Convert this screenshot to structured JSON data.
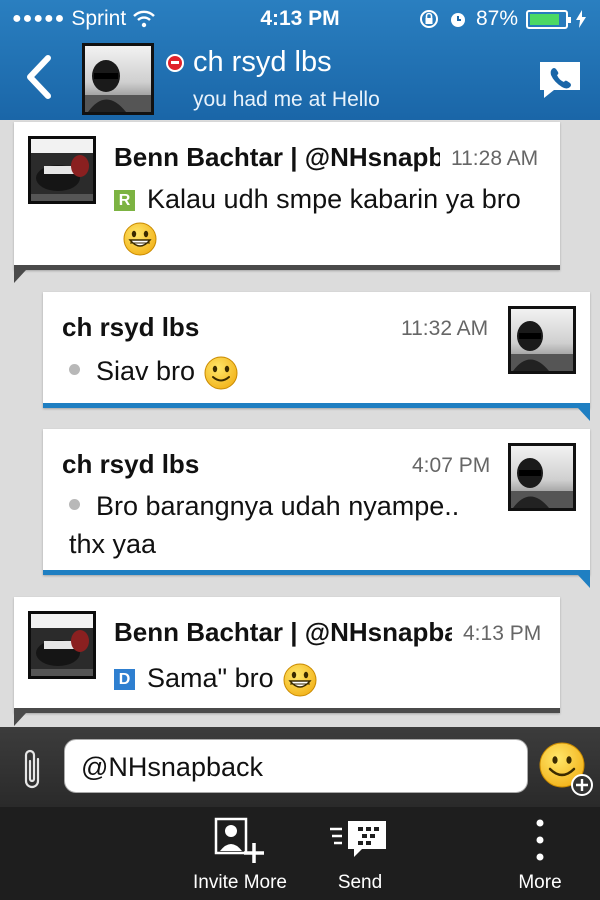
{
  "status_bar": {
    "signal_dots": "●●●●●",
    "carrier": "Sprint",
    "time": "4:13 PM",
    "battery_percent": "87%",
    "battery_level": 0.87
  },
  "header": {
    "contact_name": "ch rsyd lbs",
    "contact_status": "you had me at Hello"
  },
  "messages": [
    {
      "sender": "Benn Bachtar | @NHsnapback",
      "time": "11:28 AM",
      "badge": "R",
      "text": "Kalau udh smpe kabarin ya bro",
      "emoji": "grin"
    },
    {
      "sender": "ch rsyd lbs",
      "time": "11:32 AM",
      "text": "Siav bro",
      "emoji": "smile"
    },
    {
      "sender": "ch rsyd lbs",
      "time": "4:07 PM",
      "text": "Bro barangnya udah nyampe.. thx yaa"
    },
    {
      "sender": "Benn Bachtar | @NHsnapback",
      "time": "4:13 PM",
      "badge": "D",
      "text": "Sama\" bro",
      "emoji": "grin"
    }
  ],
  "compose": {
    "value": "@NHsnapback"
  },
  "toolbar": {
    "invite_label": "Invite More",
    "send_label": "Send",
    "more_label": "More"
  },
  "colors": {
    "header_blue": "#1a66a8",
    "outgoing_accent": "#1f7fc2",
    "incoming_accent": "#4a4a4a",
    "busy_red": "#e0202a"
  }
}
